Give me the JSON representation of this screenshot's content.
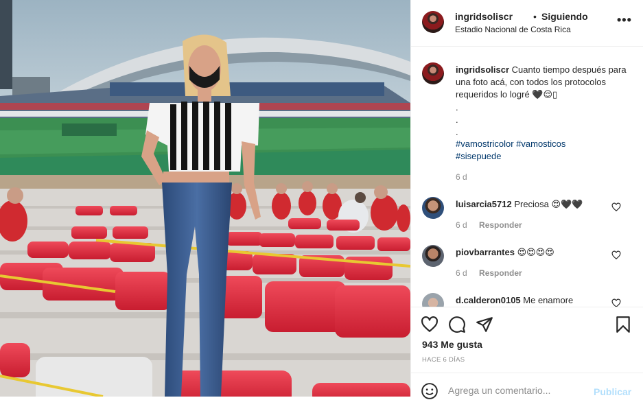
{
  "post": {
    "username": "ingridsoliscr",
    "separator": "•",
    "follow_status": "Siguiendo",
    "location": "Estadio Nacional de Costa Rica",
    "more_glyph": "•••",
    "photo_icon": "stadium-photo",
    "caption": {
      "username": "ingridsoliscr",
      "text": "Cuanto tiempo después para una foto acá, con todos los protocolos requeridos lo logré 🖤😌▯",
      "dots": [
        ".",
        ".",
        "."
      ],
      "hashtags": [
        "#vamostricolor",
        "#vamosticos",
        "#sisepuede"
      ],
      "time": "6 d"
    },
    "comments": [
      {
        "username": "luisarcia5712",
        "text": "Preciosa 😍🖤🖤",
        "time": "6 d",
        "reply": "Responder"
      },
      {
        "username": "piovbarrantes",
        "text": "😍😍😍😍",
        "time": "6 d",
        "reply": "Responder"
      },
      {
        "username": "d.calderon0105",
        "text": "Me enamore"
      }
    ],
    "likes": "943 Me gusta",
    "date": "HACE 6 DÍAS",
    "comment_placeholder": "Agrega un comentario...",
    "publish_label": "Publicar"
  },
  "colors": {
    "text": "#262626",
    "secondary": "#8e8e8e",
    "hashtag": "#00376b",
    "publish_disabled": "#b2dffc",
    "border": "#efefef",
    "seat_red": "#e0283a"
  }
}
